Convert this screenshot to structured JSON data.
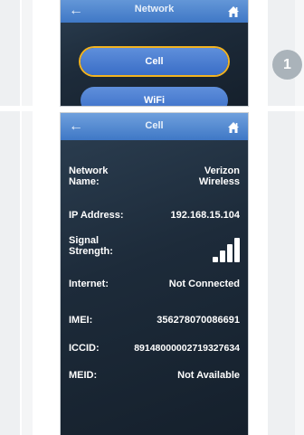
{
  "step_badge": "1",
  "network_screen": {
    "title": "Network",
    "buttons": [
      "Cell",
      "WiFi"
    ]
  },
  "cell_screen": {
    "title": "Cell",
    "rows": [
      {
        "label": "Network Name:",
        "value": "Verizon Wireless"
      },
      {
        "label": "IP Address:",
        "value": "192.168.15.104"
      },
      {
        "label": "Signal Strength:",
        "value_type": "signal-bars",
        "bars": 4,
        "bars_max": 4
      },
      {
        "label": "Internet:",
        "value": "Not Connected"
      },
      {
        "label": "IMEI:",
        "value": "356278070086691"
      },
      {
        "label": "ICCID:",
        "value": "89148000002719327634"
      },
      {
        "label": "MEID:",
        "value": "Not Available"
      }
    ]
  },
  "icons": {
    "back": "back-arrow-icon",
    "home": "home-icon"
  },
  "colors": {
    "accent_blue": "#3f78c6",
    "focus_ring": "#f2b320",
    "screen_bg": "#1d2b3a"
  }
}
